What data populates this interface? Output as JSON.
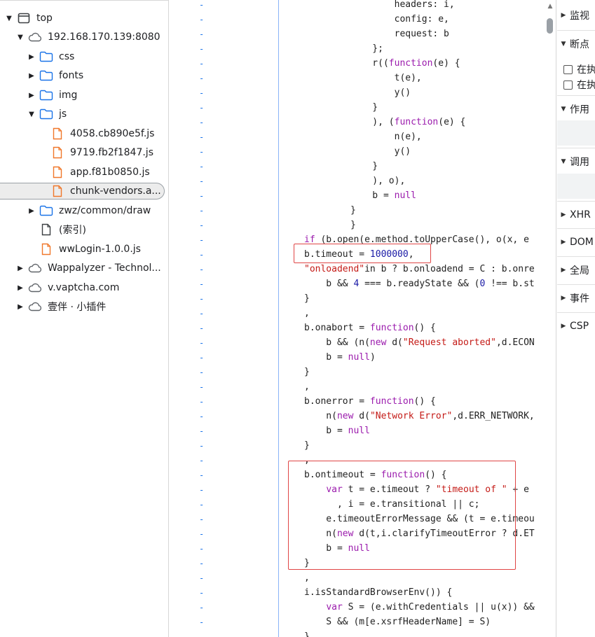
{
  "tree": {
    "items": [
      {
        "label": "top",
        "arrow": "▼",
        "icon": "frame"
      },
      {
        "label": "192.168.170.139:8080",
        "arrow": "▼",
        "icon": "cloud"
      },
      {
        "label": "css",
        "arrow": "▶",
        "icon": "folder"
      },
      {
        "label": "fonts",
        "arrow": "▶",
        "icon": "folder"
      },
      {
        "label": "img",
        "arrow": "▶",
        "icon": "folder"
      },
      {
        "label": "js",
        "arrow": "▼",
        "icon": "folder"
      },
      {
        "label": "4058.cb890e5f.js",
        "arrow": "",
        "icon": "file-js"
      },
      {
        "label": "9719.fb2f1847.js",
        "arrow": "",
        "icon": "file-js"
      },
      {
        "label": "app.f81b0850.js",
        "arrow": "",
        "icon": "file-js"
      },
      {
        "label": "chunk-vendors.a...",
        "arrow": "",
        "icon": "file-js",
        "selected": true
      },
      {
        "label": "zwz/common/draw",
        "arrow": "▶",
        "icon": "folder"
      },
      {
        "label": "(索引)",
        "arrow": "",
        "icon": "file"
      },
      {
        "label": "wwLogin-1.0.0.js",
        "arrow": "",
        "icon": "file-js"
      },
      {
        "label": "Wappalyzer - Technol...",
        "arrow": "▶",
        "icon": "cloud"
      },
      {
        "label": "v.vaptcha.com",
        "arrow": "▶",
        "icon": "cloud"
      },
      {
        "label": "壹伴 · 小插件",
        "arrow": "▶",
        "icon": "cloud"
      }
    ]
  },
  "gutter_mark": "-",
  "code_lines": [
    [
      [
        "        headers: i,",
        ""
      ]
    ],
    [
      [
        "        config: e,",
        ""
      ]
    ],
    [
      [
        "        request: b",
        ""
      ]
    ],
    [
      [
        "    };",
        ""
      ]
    ],
    [
      [
        "    r((",
        ""
      ],
      [
        "function",
        "kw"
      ],
      [
        "(e) {",
        ""
      ]
    ],
    [
      [
        "        t(e),",
        ""
      ]
    ],
    [
      [
        "        y()",
        ""
      ]
    ],
    [
      [
        "    }",
        ""
      ]
    ],
    [
      [
        "    ), (",
        ""
      ],
      [
        "function",
        "kw"
      ],
      [
        "(e) {",
        ""
      ]
    ],
    [
      [
        "        n(e),",
        ""
      ]
    ],
    [
      [
        "        y()",
        ""
      ]
    ],
    [
      [
        "    }",
        ""
      ]
    ],
    [
      [
        "    ), o),",
        ""
      ]
    ],
    [
      [
        "    b = ",
        ""
      ],
      [
        "null",
        "kw"
      ]
    ],
    [
      [
        "}",
        ""
      ]
    ],
    [
      [
        "}",
        ""
      ]
    ],
    [
      [
        "if",
        "kw"
      ],
      [
        " (b.open(e.method.toUpperCase(), o(x, e",
        ""
      ]
    ],
    [
      [
        "b.timeout = ",
        ""
      ],
      [
        "1000000",
        "num"
      ],
      [
        ",",
        ""
      ]
    ],
    [
      [
        "\"onloadend\"",
        "str"
      ],
      [
        "in b ? b.onloadend = C : b.onre",
        ""
      ]
    ],
    [
      [
        "    b && ",
        ""
      ],
      [
        "4",
        "num"
      ],
      [
        " === b.readyState && (",
        ""
      ],
      [
        "0",
        "num"
      ],
      [
        " !== b.st",
        ""
      ]
    ],
    [
      [
        "}",
        ""
      ]
    ],
    [
      [
        ",",
        ""
      ]
    ],
    [
      [
        "b.onabort = ",
        ""
      ],
      [
        "function",
        "kw"
      ],
      [
        "() {",
        ""
      ]
    ],
    [
      [
        "    b && (n(",
        ""
      ],
      [
        "new",
        "kw"
      ],
      [
        " d(",
        ""
      ],
      [
        "\"Request aborted\"",
        "str"
      ],
      [
        ",d.ECON",
        ""
      ]
    ],
    [
      [
        "    b = ",
        ""
      ],
      [
        "null",
        "kw"
      ],
      [
        ")",
        ""
      ]
    ],
    [
      [
        "}",
        ""
      ]
    ],
    [
      [
        ",",
        ""
      ]
    ],
    [
      [
        "b.onerror = ",
        ""
      ],
      [
        "function",
        "kw"
      ],
      [
        "() {",
        ""
      ]
    ],
    [
      [
        "    n(",
        ""
      ],
      [
        "new",
        "kw"
      ],
      [
        " d(",
        ""
      ],
      [
        "\"Network Error\"",
        "str"
      ],
      [
        ",d.ERR_NETWORK,",
        ""
      ]
    ],
    [
      [
        "    b = ",
        ""
      ],
      [
        "null",
        "kw"
      ]
    ],
    [
      [
        "}",
        ""
      ]
    ],
    [
      [
        ",",
        ""
      ]
    ],
    [
      [
        "b.ontimeout = ",
        ""
      ],
      [
        "function",
        "kw"
      ],
      [
        "() {",
        ""
      ]
    ],
    [
      [
        "    ",
        ""
      ],
      [
        "var",
        "kw"
      ],
      [
        " t = e.timeout ? ",
        ""
      ],
      [
        "\"timeout of \"",
        "str"
      ],
      [
        " + e",
        ""
      ]
    ],
    [
      [
        "      , i = e.transitional || c;",
        ""
      ]
    ],
    [
      [
        "    e.timeoutErrorMessage && (t = e.timeou",
        ""
      ]
    ],
    [
      [
        "    n(",
        ""
      ],
      [
        "new",
        "kw"
      ],
      [
        " d(t,i.clarifyTimeoutError ? d.ET",
        ""
      ]
    ],
    [
      [
        "    b = ",
        ""
      ],
      [
        "null",
        "kw"
      ]
    ],
    [
      [
        "}",
        ""
      ]
    ],
    [
      [
        ",",
        ""
      ]
    ],
    [
      [
        "i.isStandardBrowserEnv()) {",
        ""
      ]
    ],
    [
      [
        "    ",
        ""
      ],
      [
        "var",
        "kw"
      ],
      [
        " S = (e.withCredentials || u(x)) &&",
        ""
      ]
    ],
    [
      [
        "    S && (m[e.xsrfHeaderName] = S)",
        ""
      ]
    ],
    [
      [
        "}",
        ""
      ]
    ]
  ],
  "right_panel": {
    "sections": [
      {
        "label": "监视",
        "tri": "▶"
      },
      {
        "label": "断点",
        "tri": "▼"
      },
      {
        "label": "作用",
        "tri": "▼"
      },
      {
        "label": "调用",
        "tri": "▼"
      },
      {
        "label": "XHR",
        "tri": "▶"
      },
      {
        "label": "DOM",
        "tri": "▶"
      },
      {
        "label": "全局",
        "tri": "▶"
      },
      {
        "label": "事件",
        "tri": "▶"
      },
      {
        "label": "CSP",
        "tri": "▶"
      }
    ],
    "checkboxes": [
      {
        "label": "在执"
      },
      {
        "label": "在执"
      }
    ]
  }
}
